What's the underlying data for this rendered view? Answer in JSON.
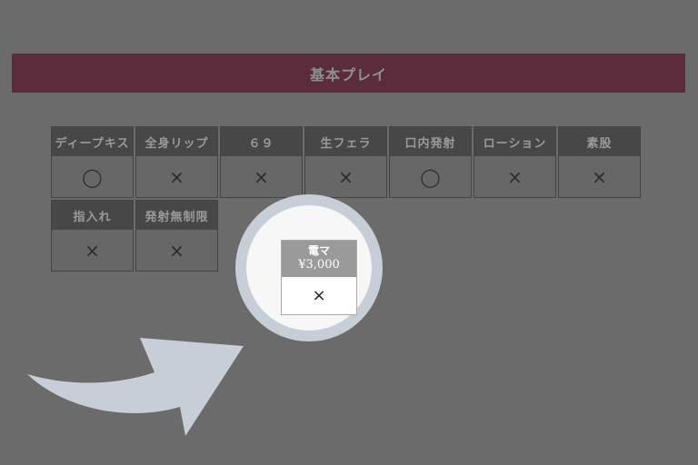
{
  "section": {
    "title": "基本プレイ"
  },
  "options": [
    {
      "label": "ディープキス",
      "value": "◯"
    },
    {
      "label": "全身リップ",
      "value": "×"
    },
    {
      "label": "６９",
      "value": "×"
    },
    {
      "label": "生フェラ",
      "value": "×"
    },
    {
      "label": "口内発射",
      "value": "◯"
    },
    {
      "label": "ローション",
      "value": "×"
    },
    {
      "label": "素股",
      "value": "×"
    },
    {
      "label": "指入れ",
      "value": "×"
    },
    {
      "label": "発射無制限",
      "value": "×"
    }
  ],
  "zoom": {
    "label": "電マ",
    "price": "¥3,000",
    "value": "×"
  },
  "colors": {
    "header_bg": "#5b2c3b",
    "magnifier_ring": "#c7ced7",
    "arrow": "#c7ced7"
  }
}
